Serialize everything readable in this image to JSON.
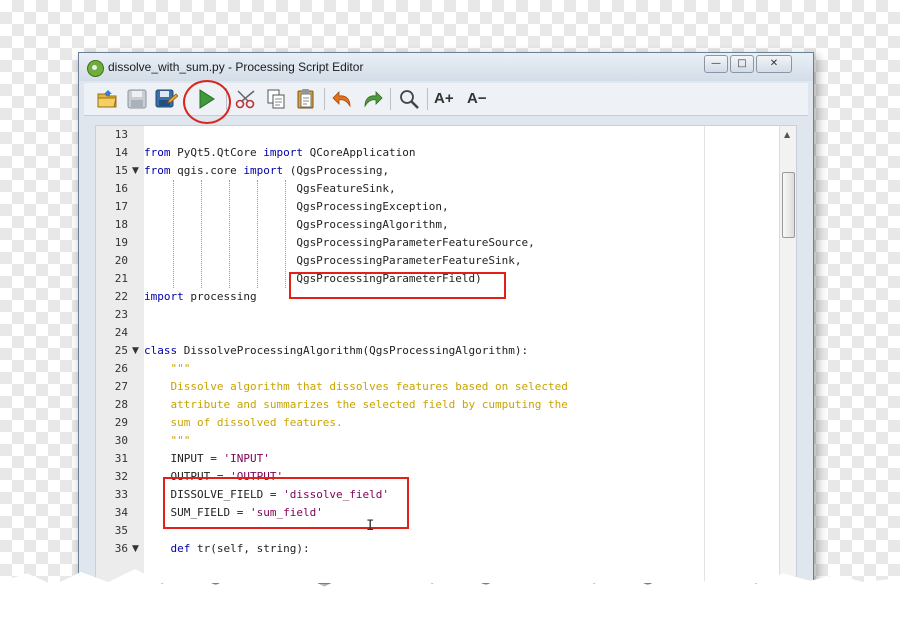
{
  "window": {
    "title": "dissolve_with_sum.py - Processing Script Editor",
    "controls": {
      "minimize": "—",
      "maximize": "□",
      "close": "✕"
    }
  },
  "toolbar": {
    "icons": [
      "open-icon",
      "save-icon",
      "save-as-icon",
      "run-icon",
      "cut-icon",
      "copy-icon",
      "paste-icon",
      "undo-icon",
      "redo-icon",
      "find-icon"
    ],
    "increase_font": "A+",
    "decrease_font": "A−",
    "highlight_color": "#d9251d"
  },
  "colors": {
    "keyword": "#0000a8",
    "docstring": "#c8a400",
    "string": "#7f0055"
  },
  "editor": {
    "lines": [
      {
        "n": "13",
        "text": ""
      },
      {
        "n": "14",
        "text": "from PyQt5.QtCore import QCoreApplication"
      },
      {
        "n": "15",
        "text": "from qgis.core import (QgsProcessing,",
        "fold": true
      },
      {
        "n": "16",
        "text": "                       QgsFeatureSink,"
      },
      {
        "n": "17",
        "text": "                       QgsProcessingException,"
      },
      {
        "n": "18",
        "text": "                       QgsProcessingAlgorithm,"
      },
      {
        "n": "19",
        "text": "                       QgsProcessingParameterFeatureSource,"
      },
      {
        "n": "20",
        "text": "                       QgsProcessingParameterFeatureSink,"
      },
      {
        "n": "21",
        "text": "                       QgsProcessingParameterField)"
      },
      {
        "n": "22",
        "text": "import processing"
      },
      {
        "n": "23",
        "text": ""
      },
      {
        "n": "24",
        "text": ""
      },
      {
        "n": "25",
        "text": "class DissolveProcessingAlgorithm(QgsProcessingAlgorithm):",
        "fold": true
      },
      {
        "n": "26",
        "text": "    \"\"\""
      },
      {
        "n": "27",
        "text": "    Dissolve algorithm that dissolves features based on selected"
      },
      {
        "n": "28",
        "text": "    attribute and summarizes the selected field by cumputing the"
      },
      {
        "n": "29",
        "text": "    sum of dissolved features."
      },
      {
        "n": "30",
        "text": "    \"\"\""
      },
      {
        "n": "31",
        "text": "    INPUT = 'INPUT'"
      },
      {
        "n": "32",
        "text": "    OUTPUT = 'OUTPUT'"
      },
      {
        "n": "33",
        "text": "    DISSOLVE_FIELD = 'dissolve_field'"
      },
      {
        "n": "34",
        "text": "    SUM_FIELD = 'sum_field'"
      },
      {
        "n": "35",
        "text": ""
      },
      {
        "n": "36",
        "text": "    def tr(self, string):",
        "fold": true
      }
    ]
  }
}
